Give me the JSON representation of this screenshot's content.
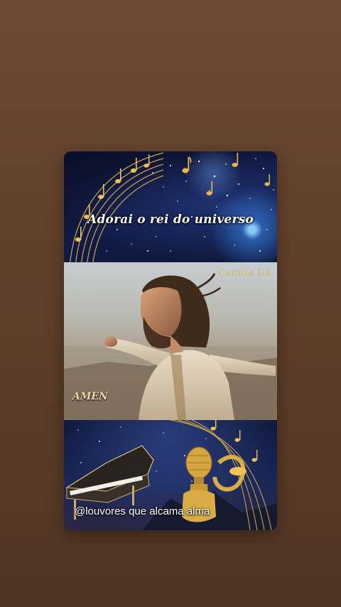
{
  "story": {
    "top_title": "Adorai o rei do universo",
    "watermark": "Canute Uk",
    "amen_label": "AMEN",
    "caption": "@louvores que alcama alma"
  },
  "colors": {
    "background": "#5f3f2a",
    "gold": "#e0b44a",
    "night_sky": "#0b1030"
  },
  "icons": [
    "music-note-icon",
    "piano-icon",
    "microphone-icon"
  ]
}
